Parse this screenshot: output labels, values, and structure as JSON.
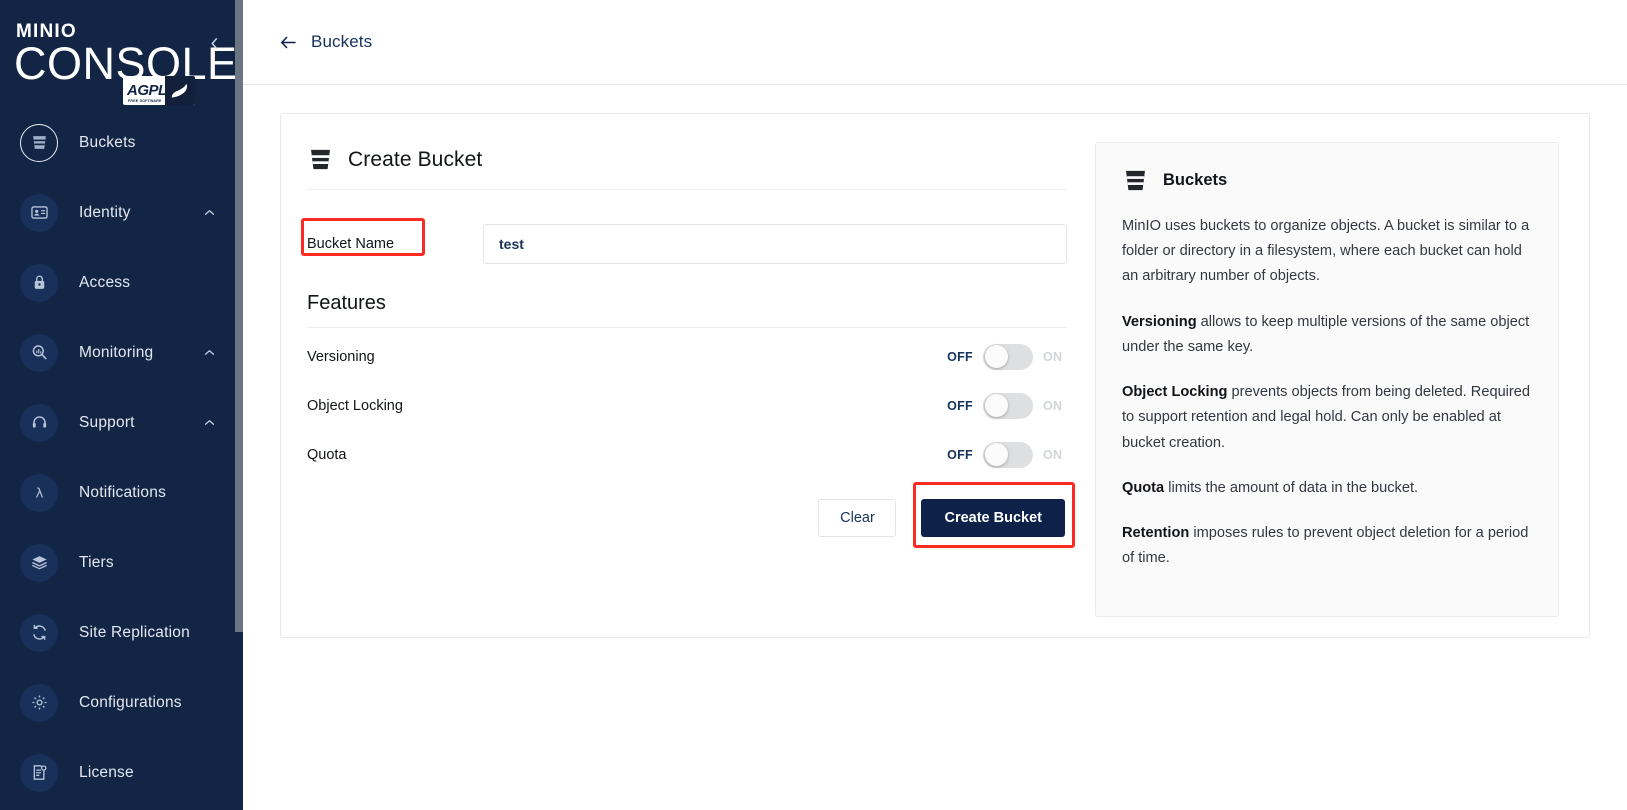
{
  "sidebar": {
    "logo": {
      "brand": "MINIO",
      "product": "CONSOLE",
      "license_badge": "AGPL",
      "license_badge_sub": "FREE SOFTWARE"
    },
    "collapse_icon": "chevron-left-icon",
    "items": [
      {
        "label": "Buckets",
        "icon": "bucket-icon",
        "active": true,
        "caret": false
      },
      {
        "label": "Identity",
        "icon": "identity-card-icon",
        "active": false,
        "caret": true
      },
      {
        "label": "Access",
        "icon": "lock-icon",
        "active": false,
        "caret": false
      },
      {
        "label": "Monitoring",
        "icon": "magnifier-chart-icon",
        "active": false,
        "caret": true
      },
      {
        "label": "Support",
        "icon": "headset-icon",
        "active": false,
        "caret": true
      },
      {
        "label": "Notifications",
        "icon": "lambda-icon",
        "active": false,
        "caret": false
      },
      {
        "label": "Tiers",
        "icon": "layers-icon",
        "active": false,
        "caret": false
      },
      {
        "label": "Site Replication",
        "icon": "refresh-cycle-icon",
        "active": false,
        "caret": false
      },
      {
        "label": "Configurations",
        "icon": "gear-icon",
        "active": false,
        "caret": false
      },
      {
        "label": "License",
        "icon": "document-badge-icon",
        "active": false,
        "caret": false
      }
    ]
  },
  "topbar": {
    "back_icon": "arrow-left-icon",
    "title": "Buckets"
  },
  "form": {
    "icon": "bucket-icon",
    "title": "Create Bucket",
    "bucket_name_label": "Bucket Name",
    "bucket_name_value": "test",
    "bucket_name_placeholder": "",
    "features_title": "Features",
    "toggles": [
      {
        "label": "Versioning",
        "off_label": "OFF",
        "on_label": "ON",
        "state": "off"
      },
      {
        "label": "Object Locking",
        "off_label": "OFF",
        "on_label": "ON",
        "state": "off"
      },
      {
        "label": "Quota",
        "off_label": "OFF",
        "on_label": "ON",
        "state": "off"
      }
    ],
    "clear_label": "Clear",
    "create_label": "Create Bucket"
  },
  "info": {
    "icon": "bucket-icon",
    "title": "Buckets",
    "paragraphs": [
      {
        "bold": "",
        "text": "MinIO uses buckets to organize objects. A bucket is similar to a folder or directory in a filesystem, where each bucket can hold an arbitrary number of objects."
      },
      {
        "bold": "Versioning",
        "text": " allows to keep multiple versions of the same object under the same key."
      },
      {
        "bold": "Object Locking",
        "text": " prevents objects from being deleted. Required to support retention and legal hold. Can only be enabled at bucket creation."
      },
      {
        "bold": "Quota",
        "text": " limits the amount of data in the bucket."
      },
      {
        "bold": "Retention",
        "text": " imposes rules to prevent object deletion for a period of time."
      }
    ]
  },
  "highlights": {
    "bucket_name_label": "#f92b22",
    "create_button": "#f92b22"
  },
  "colors": {
    "sidebar_bg": "#132544",
    "accent_dark": "#0d2149",
    "highlight_red": "#f92b22",
    "info_panel_bg": "#fafafa"
  }
}
